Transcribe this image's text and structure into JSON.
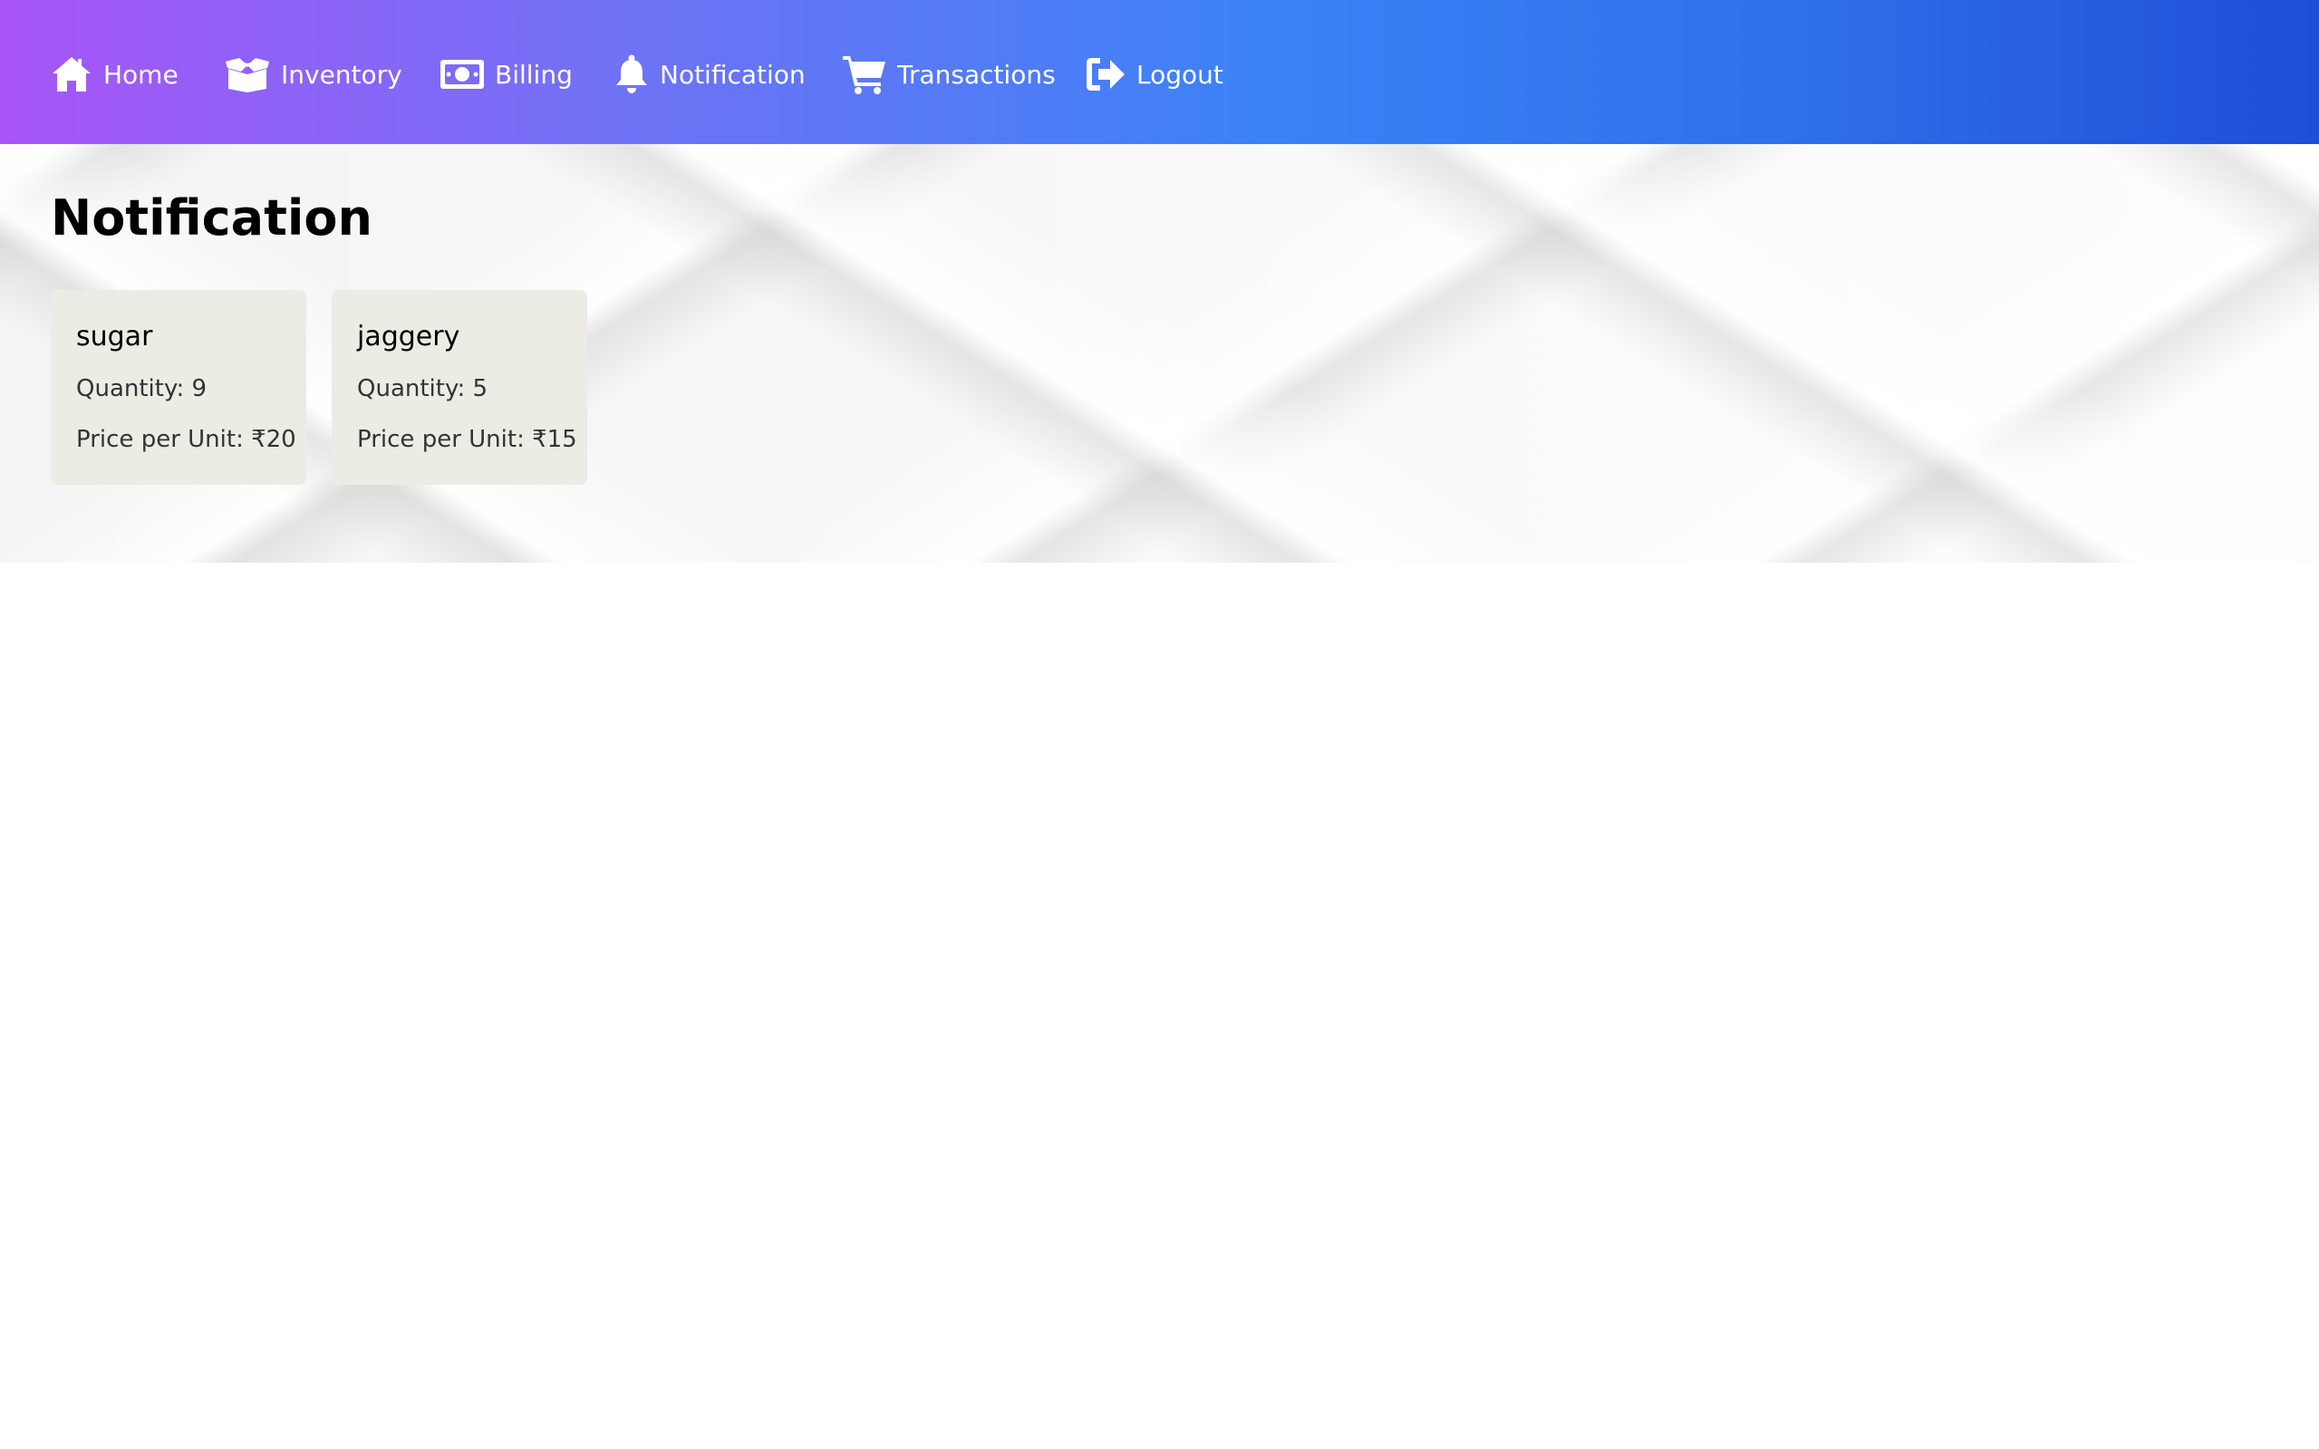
{
  "nav": {
    "items": [
      {
        "label": "Home",
        "icon": "home-icon"
      },
      {
        "label": "Inventory",
        "icon": "box-open-icon"
      },
      {
        "label": "Billing",
        "icon": "money-bill-icon"
      },
      {
        "label": "Notification",
        "icon": "bell-icon"
      },
      {
        "label": "Transactions",
        "icon": "shopping-cart-icon"
      },
      {
        "label": "Logout",
        "icon": "sign-out-icon"
      }
    ]
  },
  "page": {
    "title": "Notification"
  },
  "cards": [
    {
      "name": "sugar",
      "quantity": "Quantity: 9",
      "price": "Price per Unit: ₹20"
    },
    {
      "name": "jaggery",
      "quantity": "Quantity: 5",
      "price": "Price per Unit: ₹15"
    }
  ],
  "colors": {
    "nav_gradient_start": "#a855f7",
    "nav_gradient_mid": "#3b82f6",
    "nav_gradient_end": "#1d4ed8",
    "card_background": "#ecebe4"
  }
}
